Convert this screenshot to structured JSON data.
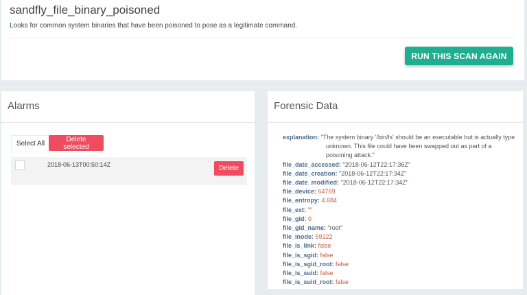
{
  "scan": {
    "title": "sandfly_file_binary_poisoned",
    "description": "Looks for common system binaries that have been poisoned to pose as a legitimate command.",
    "run_again_label": "RUN THIS SCAN AGAIN"
  },
  "alarms": {
    "title": "Alarms",
    "select_all_label": "Select All",
    "delete_selected_label": "Delete selected",
    "rows": [
      {
        "timestamp": "2018-06-13T00:50:14Z",
        "delete_label": "Delete"
      }
    ]
  },
  "forensic": {
    "title": "Forensic Data",
    "fields": [
      {
        "key": "explanation:",
        "value": "\"The system binary '/bin/ls' should be an executable but is actually type unknown. This file could have been swapped out as part of a poisoning attack.\"",
        "kind": "str"
      },
      {
        "key": "file_date_accessed:",
        "value": "\"2018-06-12T22:17:36Z\"",
        "kind": "str"
      },
      {
        "key": "file_date_creation:",
        "value": "\"2018-06-12T22:17:34Z\"",
        "kind": "str"
      },
      {
        "key": "file_date_modified:",
        "value": "\"2018-06-12T22:17:34Z\"",
        "kind": "str"
      },
      {
        "key": "file_device:",
        "value": "64769",
        "kind": "num"
      },
      {
        "key": "file_entropy:",
        "value": "4.684",
        "kind": "num"
      },
      {
        "key": "file_ext:",
        "value": "\"\"",
        "kind": "num"
      },
      {
        "key": "file_gid:",
        "value": "0",
        "kind": "num"
      },
      {
        "key": "file_gid_name:",
        "value": "\"root\"",
        "kind": "str"
      },
      {
        "key": "file_inode:",
        "value": "59122",
        "kind": "num"
      },
      {
        "key": "file_is_link:",
        "value": "false",
        "kind": "bool"
      },
      {
        "key": "file_is_sgid:",
        "value": "false",
        "kind": "bool"
      },
      {
        "key": "file_is_sgid_root:",
        "value": "false",
        "kind": "bool"
      },
      {
        "key": "file_is_suid:",
        "value": "false",
        "kind": "bool"
      },
      {
        "key": "file_is_suid_root:",
        "value": "false",
        "kind": "bool"
      }
    ]
  },
  "colors": {
    "accent_green": "#1fae8f",
    "danger_red": "#ef4d5f",
    "key_blue": "#4b6a8e",
    "value_orange": "#c06040"
  }
}
